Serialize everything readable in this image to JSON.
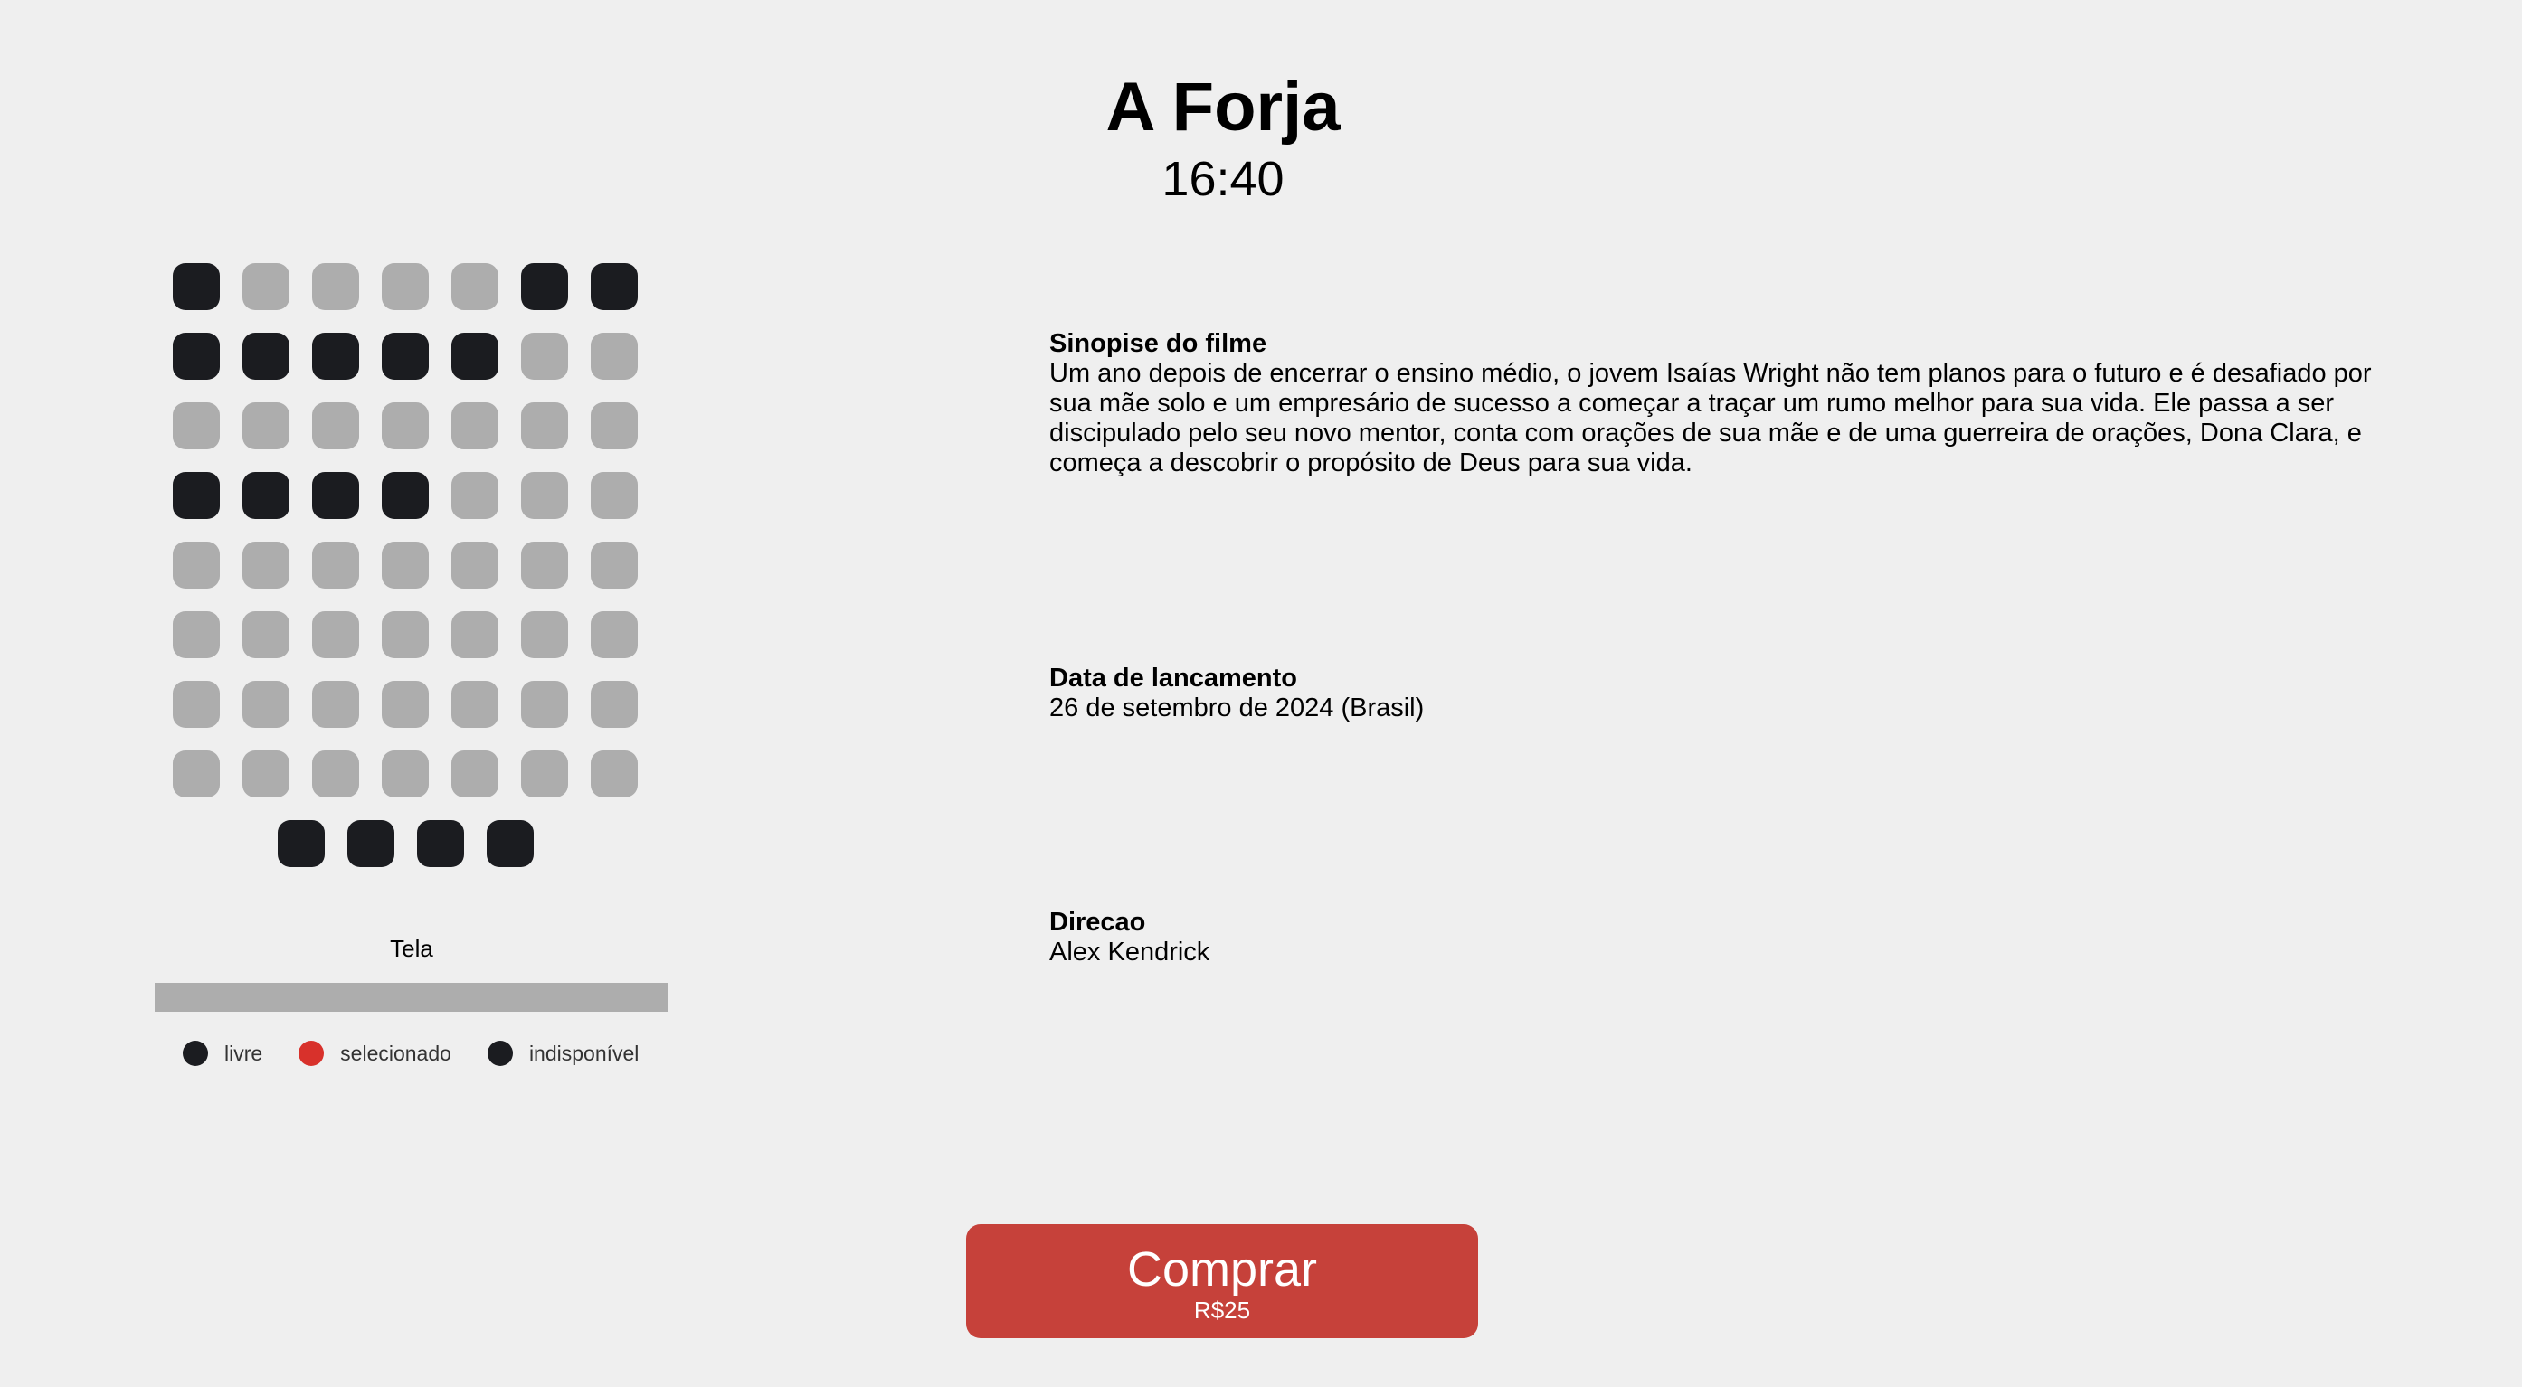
{
  "movie": {
    "title": "A Forja",
    "time": "16:40"
  },
  "seats": {
    "rows": [
      [
        "occupied",
        "free",
        "free",
        "free",
        "free",
        "occupied",
        "occupied"
      ],
      [
        "occupied",
        "occupied",
        "occupied",
        "occupied",
        "occupied",
        "free",
        "free"
      ],
      [
        "free",
        "free",
        "free",
        "free",
        "free",
        "free",
        "free"
      ],
      [
        "occupied",
        "occupied",
        "occupied",
        "occupied",
        "free",
        "free",
        "free"
      ],
      [
        "free",
        "free",
        "free",
        "free",
        "free",
        "free",
        "free"
      ],
      [
        "free",
        "free",
        "free",
        "free",
        "free",
        "free",
        "free"
      ],
      [
        "free",
        "free",
        "free",
        "free",
        "free",
        "free",
        "free"
      ],
      [
        "free",
        "free",
        "free",
        "free",
        "free",
        "free",
        "free"
      ]
    ],
    "extra_row": [
      "occupied",
      "occupied",
      "occupied",
      "occupied"
    ]
  },
  "screen": {
    "label": "Tela"
  },
  "legend": [
    {
      "label": "livre",
      "color": "#1b1c20"
    },
    {
      "label": "selecionado",
      "color": "#d8312b"
    },
    {
      "label": "indisponível",
      "color": "#1b1c20"
    }
  ],
  "info": {
    "synopsis_title": "Sinopise do filme",
    "synopsis_text": "Um ano depois de encerrar o ensino médio, o jovem Isaías Wright não tem planos para o futuro e é desafiado por sua mãe solo e um empresário de sucesso a começar a traçar um rumo melhor para sua vida. Ele passa a ser discipulado pelo seu novo mentor, conta com orações de sua mãe e de uma guerreira de orações, Dona Clara, e começa a descobrir o propósito de Deus para sua vida.",
    "release_title": "Data de lancamento",
    "release_text": "26 de setembro de 2024 (Brasil)",
    "direction_title": "Direcao",
    "direction_text": "Alex Kendrick"
  },
  "buy": {
    "label": "Comprar",
    "price": "R$25"
  },
  "colors": {
    "background": "#efefef",
    "seat_free": "#adadad",
    "seat_occupied": "#1b1c20",
    "seat_selected": "#d8312b",
    "buy_button": "#c6413a"
  }
}
